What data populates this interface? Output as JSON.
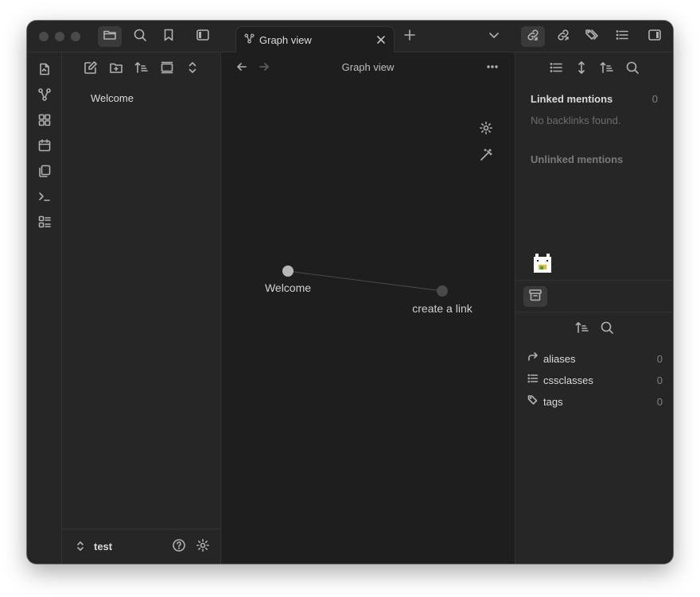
{
  "window": {
    "accent": "#7f6df2",
    "background": "#1e1e1e",
    "sidebar_background": "#262626"
  },
  "titlebar": {
    "buttons": [
      "folder-icon",
      "search-icon",
      "bookmark-icon",
      "sidebar-left-icon"
    ],
    "tab": {
      "label": "Graph view",
      "icon": "graph-icon"
    },
    "right_buttons": [
      "backlinks-icon",
      "outgoing-links-icon",
      "tags-icon",
      "outline-icon",
      "sidebar-right-icon"
    ]
  },
  "ribbon": {
    "items": [
      "open-quick-switcher-icon",
      "graph-icon",
      "canvas-icon",
      "daily-note-icon",
      "templates-icon",
      "command-palette-icon",
      "bases-icon"
    ]
  },
  "explorer": {
    "tools": [
      "new-note-icon",
      "new-folder-icon",
      "sort-icon",
      "collapse-icon",
      "expand-icon"
    ],
    "files": [
      "Welcome"
    ],
    "vault_name": "test"
  },
  "graph": {
    "title": "Graph view",
    "nodes": [
      {
        "label": "Welcome"
      },
      {
        "label": "create a link"
      }
    ]
  },
  "backlinks": {
    "linked_title": "Linked mentions",
    "linked_count": "0",
    "no_backlinks": "No backlinks found.",
    "unlinked_title": "Unlinked mentions"
  },
  "properties": {
    "items": [
      {
        "label": "aliases",
        "count": "0",
        "icon": "alias-icon"
      },
      {
        "label": "cssclasses",
        "count": "0",
        "icon": "list-icon"
      },
      {
        "label": "tags",
        "count": "0",
        "icon": "tags-icon"
      }
    ]
  }
}
